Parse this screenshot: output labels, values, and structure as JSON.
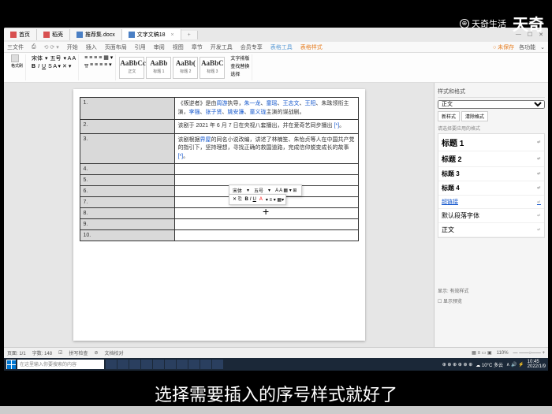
{
  "watermark": {
    "text": "天奇生活",
    "big": "天奇"
  },
  "tabs": [
    {
      "label": "首页",
      "icon": "red"
    },
    {
      "label": "稻壳",
      "icon": "red"
    },
    {
      "label": "推荐集.docx",
      "icon": "blue"
    },
    {
      "label": "文字文稿18",
      "icon": "blue",
      "active": true
    }
  ],
  "ribbon_tabs": {
    "left": [
      "三文件",
      "⎙"
    ],
    "items": [
      "开始",
      "插入",
      "页面布局",
      "引用",
      "审阅",
      "视图",
      "章节",
      "开发工具",
      "会员专享"
    ],
    "hl1": "表格工具",
    "hl2": "表格样式",
    "right": [
      "○ 未保存",
      "各功能",
      "⌄"
    ]
  },
  "ribbon": {
    "format_painter": "格式刷",
    "font": "宋体",
    "size": "五号",
    "style_labels": [
      "正文",
      "标题 1",
      "标题 2",
      "标题 3"
    ],
    "style_preview": [
      "AaBbCcDd",
      "AaBb",
      "AaBb(",
      "AaBbC"
    ],
    "find": "文字排版",
    "select": "查找替换",
    "choose": "选择"
  },
  "table": {
    "rows": [
      {
        "n": "1.",
        "c": "《叛逆者》是由<span class='link'>周游</span>执导，<span class='link'>朱一龙</span>、<span class='link'>童瑶</span>、<span class='link'>王志文</span>、<span class='link'>王阳</span>、朱珠领衔主演，<span class='link'>李强</span>、<span class='link'>张子贤</span>、<span class='link'>姚安濂</span>、<span class='link'>童义珑</span>主演的谍战剧。"
      },
      {
        "n": "2.",
        "c": "该剧于 2021 年 6 月 7 日在央视八套播出，并在爱奇艺同步播出 <span class='link'>[*]</span>。"
      },
      {
        "n": "3.",
        "c": "该剧根据<span class='link'>界屋</span>的同名小说改编，讲述了林楠笙、朱怡贞等人在中国共产党的指引下，坚持理想，寻找正确的救国道路，完成信仰蜕变成长的故事 <span class='link'>[*]</span>。"
      },
      {
        "n": "4.",
        "c": ""
      },
      {
        "n": "5.",
        "c": ""
      },
      {
        "n": "6.",
        "c": ""
      },
      {
        "n": "7.",
        "c": ""
      },
      {
        "n": "8.",
        "c": ""
      },
      {
        "n": "9.",
        "c": ""
      },
      {
        "n": "10.",
        "c": ""
      }
    ]
  },
  "mini_toolbar": {
    "font": "宋体",
    "size": "五号",
    "items": [
      "B",
      "I",
      "U",
      "A",
      "A",
      "≡",
      "▦"
    ]
  },
  "side": {
    "title": "样式和格式",
    "current": "正文",
    "new_btn": "新样式",
    "clear_btn": "清除格式",
    "sub": "请选择要应用的格式",
    "list": [
      {
        "t": "标题 1",
        "cls": "h1"
      },
      {
        "t": "标题 2",
        "cls": "h2"
      },
      {
        "t": "标题 3",
        "cls": "h3"
      },
      {
        "t": "标题 4",
        "cls": "h4"
      },
      {
        "t": "超链接",
        "cls": "link"
      },
      {
        "t": "默认段落字体",
        "cls": ""
      },
      {
        "t": "正文",
        "cls": ""
      }
    ],
    "show_label": "显示: 有效样式",
    "foot": [
      "☐ 显示预览"
    ]
  },
  "status": {
    "page": "页面: 1/1",
    "words": "字数: 148",
    "spell": "拼写检查",
    "mode": "文档校对",
    "zoom": "110%"
  },
  "taskbar": {
    "search": "在这里输入你要搜索的内容",
    "weather": "☁ 10°C 多云",
    "time": "10:45",
    "date": "2022/1/9"
  },
  "subtitle": "选择需要插入的序号样式就好了"
}
